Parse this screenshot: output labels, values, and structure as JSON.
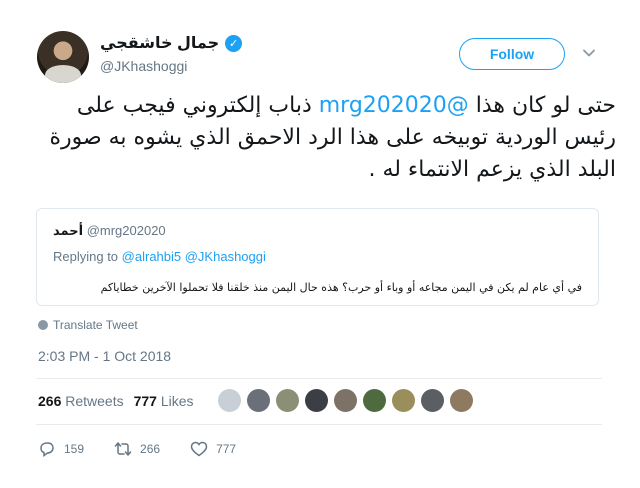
{
  "author": {
    "name": "جمال خاشقجي",
    "handle": "@JKhashoggi",
    "verified_glyph": "✓"
  },
  "follow_label": "Follow",
  "tweet": {
    "prefix": "حتى لو كان هذا ",
    "mention": "@mrg202020",
    "suffix": " ذباب إلكتروني فيجب على رئيس الوردية توبيخه على هذا الرد الاحمق الذي يشوه به صورة البلد الذي يزعم الانتماء له ."
  },
  "quote": {
    "name": "أحمد",
    "handle": "@mrg202020",
    "replying_prefix": "Replying to",
    "replying_to": "@alrahbi5 @JKhashoggi",
    "text": "في أي عام لم يكن في اليمن مجاعه أو وباء أو حرب؟ هذه حال اليمن منذ خلقنا فلا تحملوا الآخرين خطاياكم"
  },
  "translate_label": "Translate Tweet",
  "timestamp": "2:03 PM - 1 Oct 2018",
  "stats": {
    "retweets_count": "266",
    "retweets_label": "Retweets",
    "likes_count": "777",
    "likes_label": "Likes"
  },
  "liker_colors": [
    "#c9cfd6",
    "#6b6f7a",
    "#8a8f76",
    "#3b3f45",
    "#7c7266",
    "#4d6b3f",
    "#9a8f5c",
    "#5b5e63",
    "#8e7a60"
  ],
  "actions": {
    "replies": "159",
    "retweets": "266",
    "likes": "777"
  },
  "colors": {
    "accent": "#1da1f2",
    "muted": "#657786"
  }
}
